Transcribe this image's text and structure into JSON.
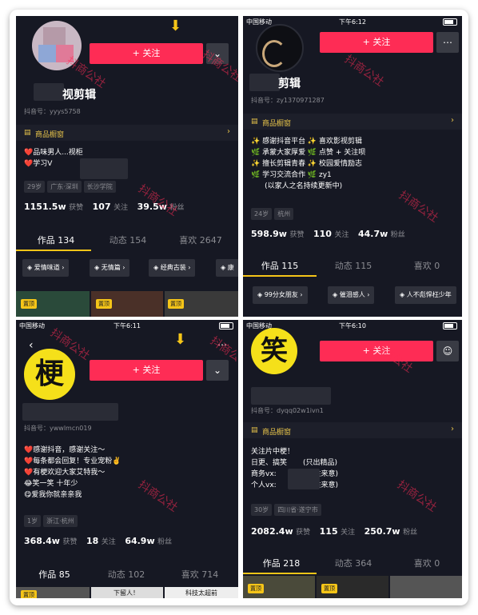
{
  "colors": {
    "accent": "#fe2c55",
    "gold": "#f5c518",
    "panel": "#161823"
  },
  "panel1": {
    "follow": "+ 关注",
    "name": "视剪辑",
    "uid": "抖音号：yyys5758",
    "shop": "商品橱窗",
    "bio": "❤️品味男人...视柜\n❤️学习V",
    "tags": [
      "29岁",
      "广东·深圳",
      "长沙学院"
    ],
    "stats": {
      "likes": "1151.5w",
      "likes_l": "获赞",
      "following": "107",
      "following_l": "关注",
      "fans": "39.5w",
      "fans_l": "粉丝"
    },
    "tabs": [
      "作品 134",
      "动态 154",
      "喜欢 2647"
    ],
    "chips": [
      "爱情味道 ›",
      "无情篇 ›",
      "经典古装 ›",
      "康"
    ],
    "pin": "置顶"
  },
  "panel2": {
    "status_left": "中国移动",
    "status_time": "下午6:12",
    "follow": "+ 关注",
    "name": "剪辑",
    "uid": "抖音号：zy1370971287",
    "shop": "商品橱窗",
    "bio": "✨ 感谢抖音平台 ✨ 喜欢影视剪辑\n🌿 承蒙大家厚爱 🌿 点赞 + 关注呗\n✨ 擅长剪辑青春 ✨ 校园爱情励志\n🌿 学习交流合作 🌿 zy1\n      (以家人之名持续更新中)",
    "tags": [
      "24岁",
      "杭州"
    ],
    "stats": {
      "likes": "598.9w",
      "likes_l": "获赞",
      "following": "110",
      "following_l": "关注",
      "fans": "44.7w",
      "fans_l": "粉丝"
    },
    "tabs": [
      "作品 115",
      "动态 115",
      "喜欢 0"
    ],
    "chips": [
      "99分女朋友 ›",
      "催泪感人 ›",
      "人不彪悍枉少年"
    ]
  },
  "panel3": {
    "status_left": "中国移动",
    "status_time": "下午6:11",
    "avatar_char": "梗",
    "follow": "+ 关注",
    "uid": "抖音号：ywwlmcn019",
    "bio": "❤️感谢抖音，感谢关注～\n❤️每条都会回复！专业宠粉✌️\n❤️有梗欢迎大家艾特我～\n😂笑一笑 十年少\n😋爱我你就亲亲我",
    "tags": [
      "1岁",
      "浙江·杭州"
    ],
    "stats": {
      "likes": "368.4w",
      "likes_l": "获赞",
      "following": "18",
      "following_l": "关注",
      "fans": "64.9w",
      "fans_l": "粉丝"
    },
    "tabs": [
      "作品 85",
      "动态 102",
      "喜欢 714"
    ],
    "pin": "置顶",
    "thumb_captions": [
      "下留人！",
      "科技太超前"
    ]
  },
  "panel4": {
    "status_left": "中国移动",
    "status_time": "下午6:10",
    "avatar_char": "笑",
    "follow": "+ 关注",
    "uid": "抖音号：dyqq02w1ivn1",
    "shop": "商品橱窗",
    "bio": "关注片中梗！\n日更、搞笑       (只出精品)\n商务vx:            (备注来意)\n个人vx:            (备注来意)",
    "tags": [
      "30岁",
      "四川省·遂宁市"
    ],
    "stats": {
      "likes": "2082.4w",
      "likes_l": "获赞",
      "following": "115",
      "following_l": "关注",
      "fans": "250.7w",
      "fans_l": "粉丝"
    },
    "tabs": [
      "作品 218",
      "动态 364",
      "喜欢 0"
    ],
    "pin": "置顶"
  },
  "watermark": "抖商公社"
}
